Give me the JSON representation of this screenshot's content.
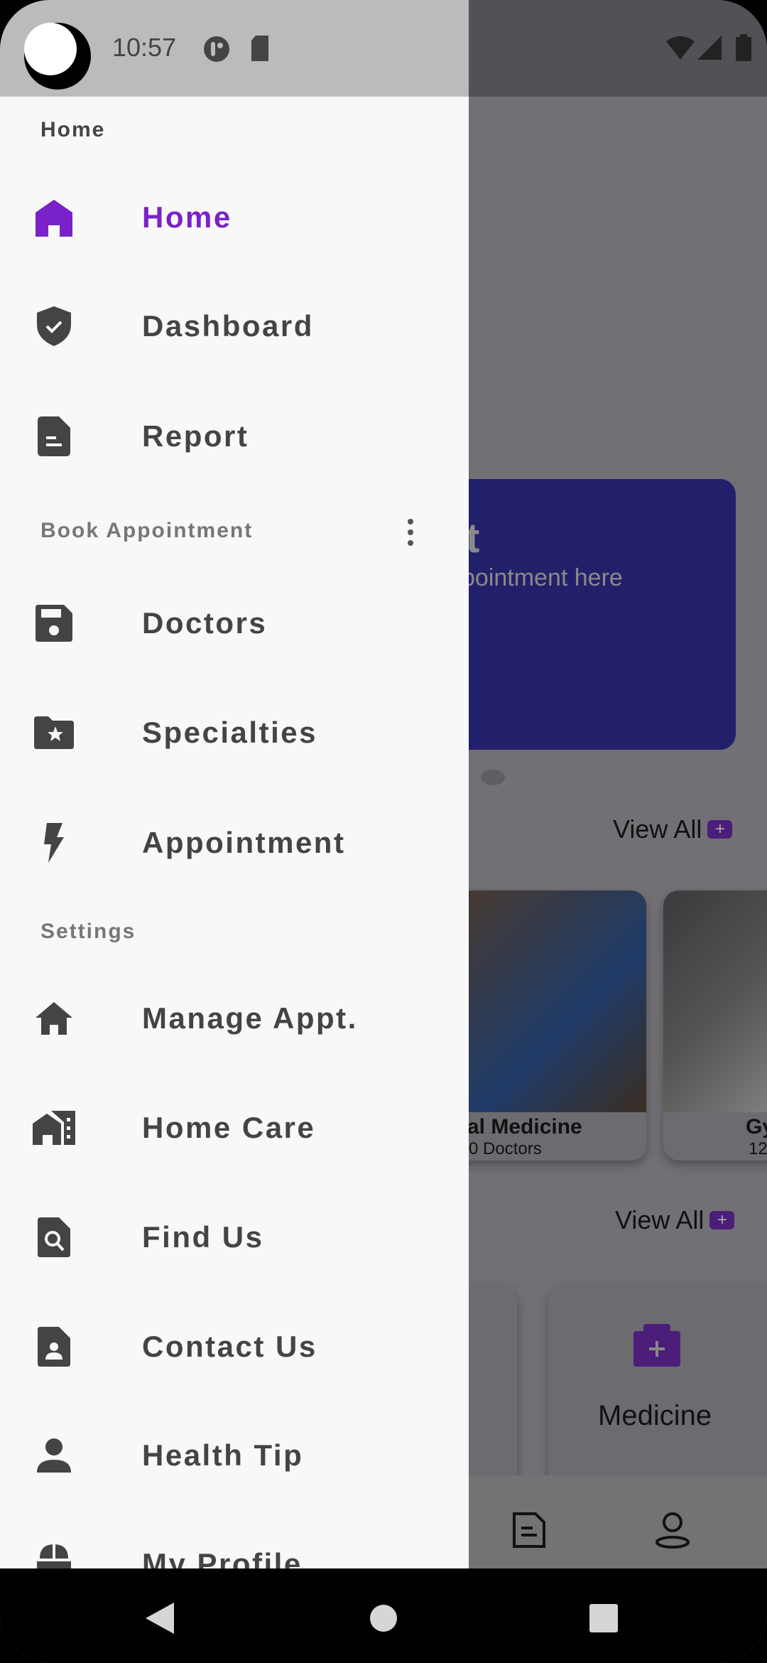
{
  "status_bar": {
    "time": "10:57",
    "icons": [
      "moon-icon",
      "app-icon",
      "sd-card-icon",
      "wifi-icon",
      "signal-icon",
      "battery-icon"
    ]
  },
  "drawer": {
    "sections": [
      {
        "title": "Home",
        "items": [
          {
            "label": "Home",
            "icon": "home-icon",
            "active": true
          },
          {
            "label": "Dashboard",
            "icon": "shield-check-icon"
          },
          {
            "label": "Report",
            "icon": "document-icon"
          }
        ]
      },
      {
        "title": "Book Appointment",
        "items": [
          {
            "label": "Doctors",
            "icon": "save-icon"
          },
          {
            "label": "Specialties",
            "icon": "folder-star-icon"
          },
          {
            "label": "Appointment",
            "icon": "bolt-icon"
          }
        ]
      },
      {
        "title": "Settings",
        "items": [
          {
            "label": "Manage Appt.",
            "icon": "house-icon"
          },
          {
            "label": "Home Care",
            "icon": "home-work-icon"
          },
          {
            "label": "Find Us",
            "icon": "find-in-page-icon"
          },
          {
            "label": "Contact Us",
            "icon": "contact-page-icon"
          },
          {
            "label": "Health Tip",
            "icon": "person-icon"
          },
          {
            "label": "My Profile",
            "icon": "profile-icon"
          }
        ]
      }
    ]
  },
  "background": {
    "banner_title": "t",
    "banner_subtitle": "pointment here",
    "view_all": "View All",
    "plus": "+",
    "cards": [
      {
        "title": "al Medicine",
        "subtitle": "0 Doctors"
      },
      {
        "title": "Gy",
        "subtitle": "12"
      }
    ],
    "category": "Medicine"
  },
  "colors": {
    "accent": "#7a22c9",
    "banner": "#23206b"
  }
}
